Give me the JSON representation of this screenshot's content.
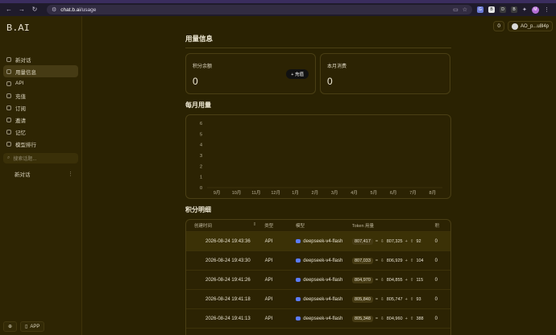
{
  "browser": {
    "url_host": "chat.b.ai",
    "url_path": "/usage",
    "profile_initial": "M",
    "ext_labels": [
      "G",
      "B",
      "D",
      "B"
    ]
  },
  "sidebar": {
    "logo": "B.AI",
    "items": [
      {
        "label": "新对话",
        "active": false
      },
      {
        "label": "用量信息",
        "active": true
      },
      {
        "label": "API",
        "active": false
      },
      {
        "label": "充值",
        "active": false
      },
      {
        "label": "订阅",
        "active": false
      },
      {
        "label": "邀请",
        "active": false
      },
      {
        "label": "记忆",
        "active": false
      },
      {
        "label": "模型排行",
        "active": false
      }
    ],
    "search_placeholder": "搜索话题...",
    "history_item": "新对话",
    "app_label": "APP"
  },
  "header": {
    "credit_count": "0",
    "user_name": "AO_p...u8l4p"
  },
  "usage": {
    "title": "用量信息",
    "balance_label": "积分余额",
    "balance_value": "0",
    "recharge_label": "+ 充值",
    "month_label": "本月消费",
    "month_value": "0",
    "monthly_title": "每月用量",
    "detail_title": "积分明细"
  },
  "chart_data": {
    "type": "bar",
    "categories": [
      "9月",
      "10月",
      "11月",
      "12月",
      "1月",
      "2月",
      "3月",
      "4月",
      "5月",
      "6月",
      "7月",
      "8月"
    ],
    "values": [
      0,
      0,
      0,
      0,
      0,
      0,
      0,
      0,
      0,
      0,
      0,
      0
    ],
    "ylim": [
      0,
      6
    ],
    "yticks": [
      "0",
      "1",
      "2",
      "3",
      "4",
      "5",
      "6"
    ],
    "grid": false
  },
  "table": {
    "headers": [
      "创建时间",
      "类型",
      "模型",
      "Token 用量",
      "积"
    ],
    "rows": [
      {
        "time": "2026-08-24 19:43:36",
        "type": "API",
        "model": "deepseek-v4-flash",
        "total": "807,417",
        "input": "807,325",
        "output": "92",
        "credits": "0"
      },
      {
        "time": "2026-08-24 19:43:30",
        "type": "API",
        "model": "deepseek-v4-flash",
        "total": "807,033",
        "input": "806,929",
        "output": "104",
        "credits": "0"
      },
      {
        "time": "2026-08-24 19:41:26",
        "type": "API",
        "model": "deepseek-v4-flash",
        "total": "804,970",
        "input": "804,855",
        "output": "115",
        "credits": "0"
      },
      {
        "time": "2026-08-24 19:41:18",
        "type": "API",
        "model": "deepseek-v4-flash",
        "total": "805,840",
        "input": "805,747",
        "output": "93",
        "credits": "0"
      },
      {
        "time": "2026-08-24 19:41:13",
        "type": "API",
        "model": "deepseek-v4-flash",
        "total": "805,348",
        "input": "804,960",
        "output": "388",
        "credits": "0"
      }
    ]
  }
}
